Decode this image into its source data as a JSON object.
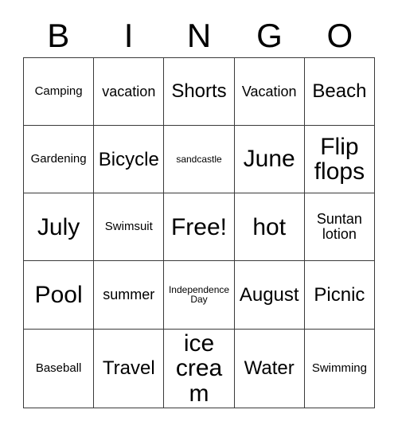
{
  "header": {
    "letters": [
      "B",
      "I",
      "N",
      "G",
      "O"
    ]
  },
  "grid": {
    "rows": [
      [
        {
          "text": "Camping",
          "size": "sm"
        },
        {
          "text": "vacation",
          "size": "md"
        },
        {
          "text": "Shorts",
          "size": "lg"
        },
        {
          "text": "Vacation",
          "size": "md"
        },
        {
          "text": "Beach",
          "size": "lg"
        }
      ],
      [
        {
          "text": "Gardening",
          "size": "sm"
        },
        {
          "text": "Bicycle",
          "size": "lg"
        },
        {
          "text": "sandcastle",
          "size": "xs"
        },
        {
          "text": "June",
          "size": "xl"
        },
        {
          "text": "Flip flops",
          "size": "xl"
        }
      ],
      [
        {
          "text": "July",
          "size": "xl"
        },
        {
          "text": "Swimsuit",
          "size": "sm"
        },
        {
          "text": "Free!",
          "size": "xl"
        },
        {
          "text": "hot",
          "size": "xl"
        },
        {
          "text": "Suntan lotion",
          "size": "md"
        }
      ],
      [
        {
          "text": "Pool",
          "size": "xl"
        },
        {
          "text": "summer",
          "size": "md"
        },
        {
          "text": "Independence Day",
          "size": "xs"
        },
        {
          "text": "August",
          "size": "lg"
        },
        {
          "text": "Picnic",
          "size": "lg"
        }
      ],
      [
        {
          "text": "Baseball",
          "size": "sm"
        },
        {
          "text": "Travel",
          "size": "lg"
        },
        {
          "text": "ice cream",
          "size": "xl"
        },
        {
          "text": "Water",
          "size": "lg"
        },
        {
          "text": "Swimming",
          "size": "sm"
        }
      ]
    ]
  },
  "colors": {
    "border": "#3a3a3a",
    "background": "#ffffff",
    "text": "#000000"
  }
}
